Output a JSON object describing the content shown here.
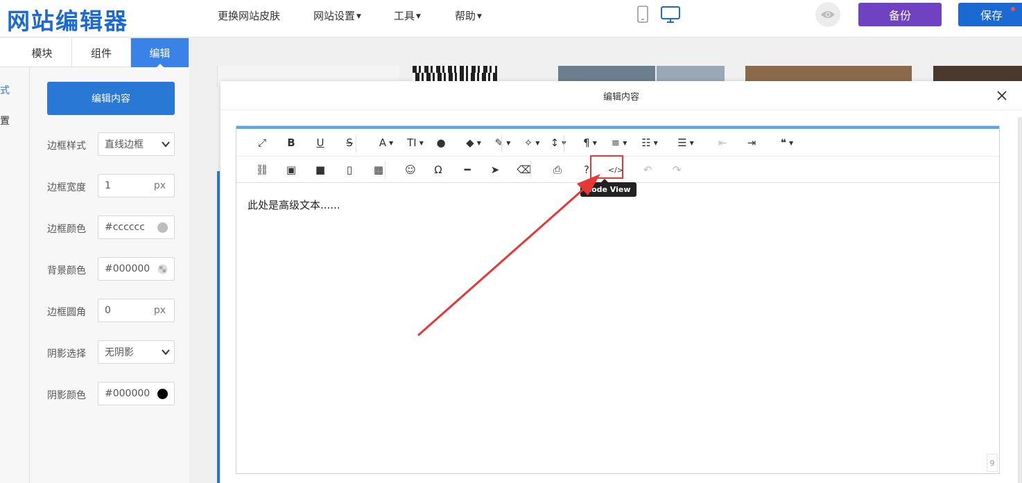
{
  "app": {
    "logo": "网站编辑器"
  },
  "nav": {
    "items": [
      {
        "label": "更换网站皮肤",
        "caret": false
      },
      {
        "label": "网站设置",
        "caret": true
      },
      {
        "label": "工具",
        "caret": true
      },
      {
        "label": "帮助",
        "caret": true
      }
    ],
    "backup_label": "备份",
    "save_label": "保存"
  },
  "colors": {
    "brand": "#1b6ad3",
    "backup": "#6f42c1",
    "highlight": "#e53935"
  },
  "panel": {
    "tabs": [
      {
        "label": "模块",
        "active": false
      },
      {
        "label": "组件",
        "active": false
      },
      {
        "label": "编辑",
        "active": true
      }
    ],
    "side_labels": [
      "式",
      "置"
    ],
    "edit_button": "编辑内容",
    "props": [
      {
        "label": "边框样式",
        "value": "直线边框",
        "kind": "select"
      },
      {
        "label": "边框宽度",
        "value": "1",
        "suffix": "px",
        "kind": "number"
      },
      {
        "label": "边框颜色",
        "value": "#cccccc",
        "swatch": "#bdbdbd",
        "kind": "color"
      },
      {
        "label": "背景颜色",
        "value": "#000000",
        "swatch": "transparent",
        "kind": "color"
      },
      {
        "label": "边框圆角",
        "value": "0",
        "suffix": "px",
        "kind": "number"
      },
      {
        "label": "阴影选择",
        "value": "无阴影",
        "kind": "select"
      },
      {
        "label": "阴影颜色",
        "value": "#000000",
        "swatch": "#000000",
        "kind": "color"
      }
    ]
  },
  "modal": {
    "title": "编辑内容",
    "tooltip": "Code View",
    "content": "此处是高级文本......",
    "counter": "9",
    "toolbar_row1": [
      {
        "icon": "fullscreen-icon",
        "glyph": "⤢",
        "dropdown": false
      },
      {
        "icon": "bold-icon",
        "glyph": "B",
        "dropdown": false
      },
      {
        "icon": "underline-icon",
        "glyph": "U",
        "dropdown": false
      },
      {
        "icon": "strikethrough-icon",
        "glyph": "S",
        "dropdown": false
      },
      {
        "icon": "font-family-icon",
        "glyph": "A",
        "dropdown": true
      },
      {
        "icon": "font-size-icon",
        "glyph": "TI",
        "dropdown": true
      },
      {
        "icon": "text-color-icon",
        "glyph": "●",
        "dropdown": false
      },
      {
        "icon": "tag-icon",
        "glyph": "◆",
        "dropdown": true
      },
      {
        "icon": "brush-icon",
        "glyph": "✎",
        "dropdown": true
      },
      {
        "icon": "magic-wand-icon",
        "glyph": "✧",
        "dropdown": true
      },
      {
        "icon": "line-height-icon",
        "glyph": "↕",
        "dropdown": true
      },
      {
        "icon": "paragraph-icon",
        "glyph": "¶",
        "dropdown": true
      },
      {
        "icon": "align-icon",
        "glyph": "≡",
        "dropdown": true
      },
      {
        "icon": "ordered-list-icon",
        "glyph": "☷",
        "dropdown": true
      },
      {
        "icon": "unordered-list-icon",
        "glyph": "☰",
        "dropdown": true
      },
      {
        "icon": "outdent-icon",
        "glyph": "⇤",
        "dropdown": false
      },
      {
        "icon": "indent-icon",
        "glyph": "⇥",
        "dropdown": false
      },
      {
        "icon": "quote-icon",
        "glyph": "❝",
        "dropdown": true
      }
    ],
    "toolbar_row2": [
      {
        "icon": "link-icon",
        "glyph": "⛓"
      },
      {
        "icon": "image-icon",
        "glyph": "▣"
      },
      {
        "icon": "video-icon",
        "glyph": "■"
      },
      {
        "icon": "file-icon",
        "glyph": "▯"
      },
      {
        "icon": "table-icon",
        "glyph": "▦"
      },
      {
        "icon": "emoji-icon",
        "glyph": "☺"
      },
      {
        "icon": "special-char-icon",
        "glyph": "Ω"
      },
      {
        "icon": "horizontal-rule-icon",
        "glyph": "━"
      },
      {
        "icon": "select-cursor-icon",
        "glyph": "➤"
      },
      {
        "icon": "eraser-icon",
        "glyph": "⌫"
      },
      {
        "icon": "print-icon",
        "glyph": "⎙"
      },
      {
        "icon": "help-icon",
        "glyph": "?"
      },
      {
        "icon": "code-view-icon",
        "glyph": "</>"
      },
      {
        "icon": "undo-icon",
        "glyph": "↶"
      },
      {
        "icon": "redo-icon",
        "glyph": "↷"
      }
    ]
  }
}
